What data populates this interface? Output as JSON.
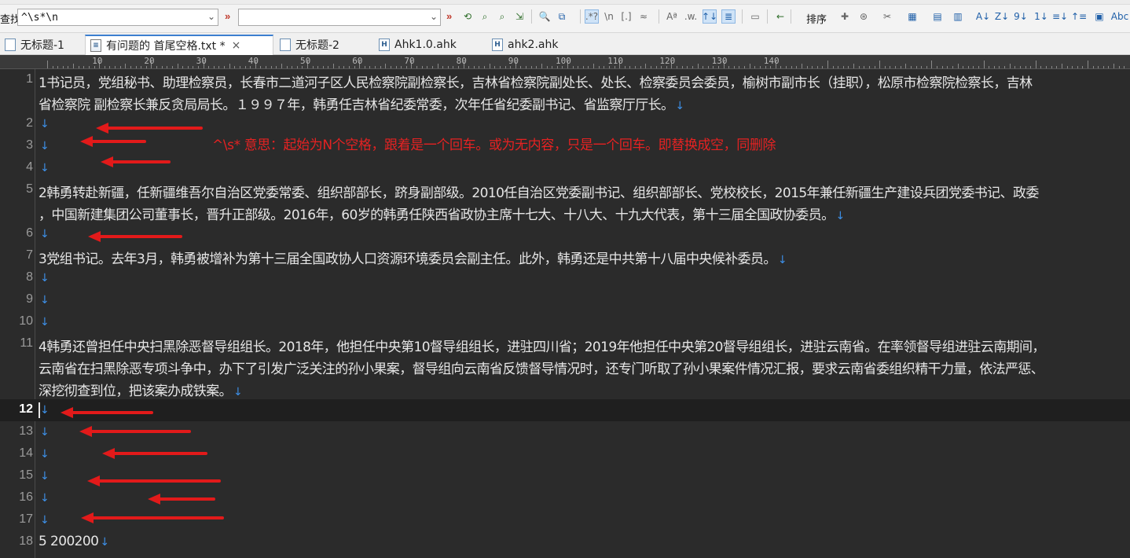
{
  "toolbar": {
    "find_label": "查找",
    "find_value": "^\\s*\\n",
    "replace_value": "",
    "sort_label": "排序",
    "buttons": [
      {
        "name": "find-next-icon",
        "glyph": "⟲"
      },
      {
        "name": "find-prev-icon",
        "glyph": "⌕"
      },
      {
        "name": "find-all-icon",
        "glyph": "⌕"
      },
      {
        "name": "replace-icon",
        "glyph": "⇲"
      },
      {
        "name": "search-options-icon",
        "glyph": "🔍"
      },
      {
        "name": "copy-results-icon",
        "glyph": "⧉"
      },
      {
        "name": "regex-toggle-icon",
        "glyph": ".*?"
      },
      {
        "name": "escape-toggle-icon",
        "glyph": "\\n"
      },
      {
        "name": "brackets-icon",
        "glyph": "[.]"
      },
      {
        "name": "fuzzy-icon",
        "glyph": "≈"
      },
      {
        "name": "case-icon",
        "glyph": "Aª"
      },
      {
        "name": "word-icon",
        "glyph": ".w."
      },
      {
        "name": "updown-icon",
        "glyph": "↑↓"
      },
      {
        "name": "highlight-icon",
        "glyph": "≣"
      },
      {
        "name": "window-icon",
        "glyph": "▭"
      },
      {
        "name": "back-icon",
        "glyph": "←"
      }
    ],
    "sort_buttons": [
      "✚",
      "⊛",
      "✂",
      "▦",
      "▤",
      "▥",
      "A↓",
      "Z↓",
      "9↓",
      "1↓",
      "≡↓",
      "↑≡",
      "▣",
      "Abc"
    ]
  },
  "tabs": [
    {
      "label": "无标题-1",
      "icon": "doc",
      "active": false
    },
    {
      "label": "有问题的  首尾空格.txt *",
      "icon": "txt",
      "active": true
    },
    {
      "label": "无标题-2",
      "icon": "doc",
      "active": false
    },
    {
      "label": "Ahk1.0.ahk",
      "icon": "H",
      "active": false
    },
    {
      "label": "ahk2.ahk",
      "icon": "H",
      "active": false
    }
  ],
  "ruler": {
    "marks": [
      "10",
      "20",
      "30",
      "40",
      "50",
      "60",
      "70",
      "80",
      "90",
      "100",
      "110",
      "120",
      "130",
      "140"
    ]
  },
  "editor": {
    "eol_glyph": "↓",
    "current_line": 12,
    "lines": [
      {
        "num": "1",
        "rows": [
          "1书记员，党组秘书、助理检察员，长春市二道河子区人民检察院副检察长，吉林省检察院副处长、处长、检察委员会委员，榆树市副市长（挂职），松原市检察院检察长，吉林",
          "省检察院 副检察长兼反贪局局长。１９９７年，韩勇任吉林省纪委常委，次年任省纪委副书记、省监察厅厅长。"
        ]
      },
      {
        "num": "2",
        "rows": [
          ""
        ]
      },
      {
        "num": "3",
        "rows": [
          ""
        ]
      },
      {
        "num": "4",
        "rows": [
          ""
        ]
      },
      {
        "num": "5",
        "rows": [
          "2韩勇转赴新疆，任新疆维吾尔自治区党委常委、组织部部长，跻身副部级。2010任自治区党委副书记、组织部部长、党校校长，2015年兼任新疆生产建设兵团党委书记、政委",
          "，中国新建集团公司董事长，晋升正部级。2016年，60岁的韩勇任陕西省政协主席十七大、十八大、十九大代表，第十三届全国政协委员。"
        ]
      },
      {
        "num": "6",
        "rows": [
          ""
        ]
      },
      {
        "num": "7",
        "rows": [
          "3党组书记。去年3月，韩勇被增补为第十三届全国政协人口资源环境委员会副主任。此外，韩勇还是中共第十八届中央候补委员。"
        ]
      },
      {
        "num": "8",
        "rows": [
          ""
        ]
      },
      {
        "num": "9",
        "rows": [
          ""
        ]
      },
      {
        "num": "10",
        "rows": [
          ""
        ]
      },
      {
        "num": "11",
        "rows": [
          "4韩勇还曾担任中央扫黑除恶督导组组长。2018年，他担任中央第10督导组组长，进驻四川省；2019年他担任中央第20督导组组长，进驻云南省。在率领督导组进驻云南期间，",
          "云南省在扫黑除恶专项斗争中，办下了引发广泛关注的孙小果案，督导组向云南省反馈督导情况时，还专门听取了孙小果案件情况汇报，要求云南省委组织精干力量，依法严惩、",
          "深挖彻查到位，把该案办成铁案。"
        ]
      },
      {
        "num": "12",
        "rows": [
          ""
        ]
      },
      {
        "num": "13",
        "rows": [
          ""
        ]
      },
      {
        "num": "14",
        "rows": [
          ""
        ]
      },
      {
        "num": "15",
        "rows": [
          ""
        ]
      },
      {
        "num": "16",
        "rows": [
          ""
        ]
      },
      {
        "num": "17",
        "rows": [
          ""
        ]
      },
      {
        "num": "18",
        "rows": [
          "5   200200"
        ]
      }
    ],
    "annotation": "^\\s*  意思：起始为N个空格，跟着是一个回车。或为无内容，只是一个回车。即替换成空，同删除"
  },
  "colors": {
    "editor_bg": "#2b2b2b",
    "text": "#e6e6e6",
    "eol": "#3d8fe6",
    "annotation": "#e52222"
  }
}
